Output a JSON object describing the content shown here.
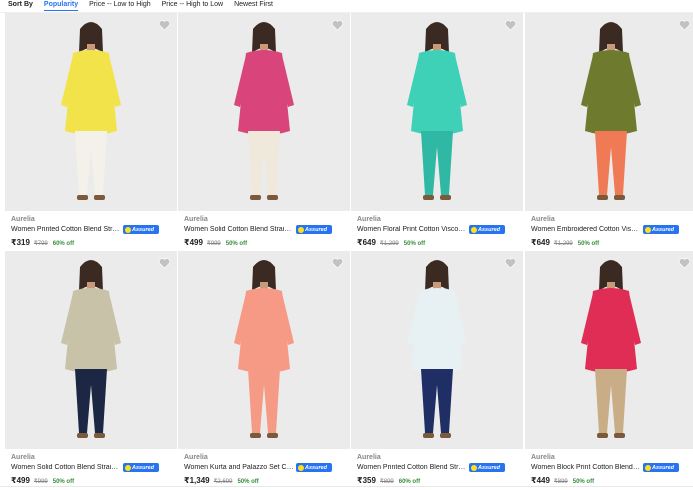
{
  "sort": {
    "label": "Sort By",
    "options": [
      "Popularity",
      "Price -- Low to High",
      "Price -- High to Low",
      "Newest First"
    ],
    "active": "Popularity"
  },
  "assured_label": "Assured",
  "colors": {
    "accent": "#2874f0",
    "discount": "#388e3c",
    "assured_badge": "#2874f0"
  },
  "products": [
    {
      "brand": "Aurelia",
      "title": "Women Printed Cotton Blend Straight Kurta",
      "price": "₹319",
      "mrp": "₹799",
      "off": "60% off",
      "kurta_color": "#f3e34a",
      "bottom_color": "#f4f1ea"
    },
    {
      "brand": "Aurelia",
      "title": "Women Solid Cotton Blend Straight Kurta",
      "price": "₹499",
      "mrp": "₹999",
      "off": "50% off",
      "kurta_color": "#d9457a",
      "bottom_color": "#efe8db"
    },
    {
      "brand": "Aurelia",
      "title": "Women Floral Print Cotton Viscose Anarkali Kurta",
      "price": "₹649",
      "mrp": "₹1,299",
      "off": "50% off",
      "kurta_color": "#3fd0b8",
      "bottom_color": "#2fb8a3"
    },
    {
      "brand": "Aurelia",
      "title": "Women Embroidered Cotton Viscose Kurta Salwar",
      "price": "₹649",
      "mrp": "₹1,299",
      "off": "50% off",
      "kurta_color": "#6e7a2e",
      "bottom_color": "#f07a55"
    },
    {
      "brand": "Aurelia",
      "title": "Women Solid Cotton Blend Straight Kurta",
      "price": "₹499",
      "mrp": "₹999",
      "off": "50% off",
      "kurta_color": "#c8c2a8",
      "bottom_color": "#1c2744"
    },
    {
      "brand": "Aurelia",
      "title": "Women Kurta and Palazzo Set Cotton Blend",
      "price": "₹1,349",
      "mrp": "₹2,699",
      "off": "50% off",
      "kurta_color": "#f79a85",
      "bottom_color": "#f59a84"
    },
    {
      "brand": "Aurelia",
      "title": "Women Printed Cotton Blend Straight Kurta",
      "price": "₹359",
      "mrp": "₹899",
      "off": "60% off",
      "kurta_color": "#e7f0f2",
      "bottom_color": "#1f2f66"
    },
    {
      "brand": "Aurelia",
      "title": "Women Block Print Cotton Blend Kurta",
      "price": "₹449",
      "mrp": "₹899",
      "off": "50% off",
      "kurta_color": "#e02d55",
      "bottom_color": "#c8ad86"
    }
  ]
}
